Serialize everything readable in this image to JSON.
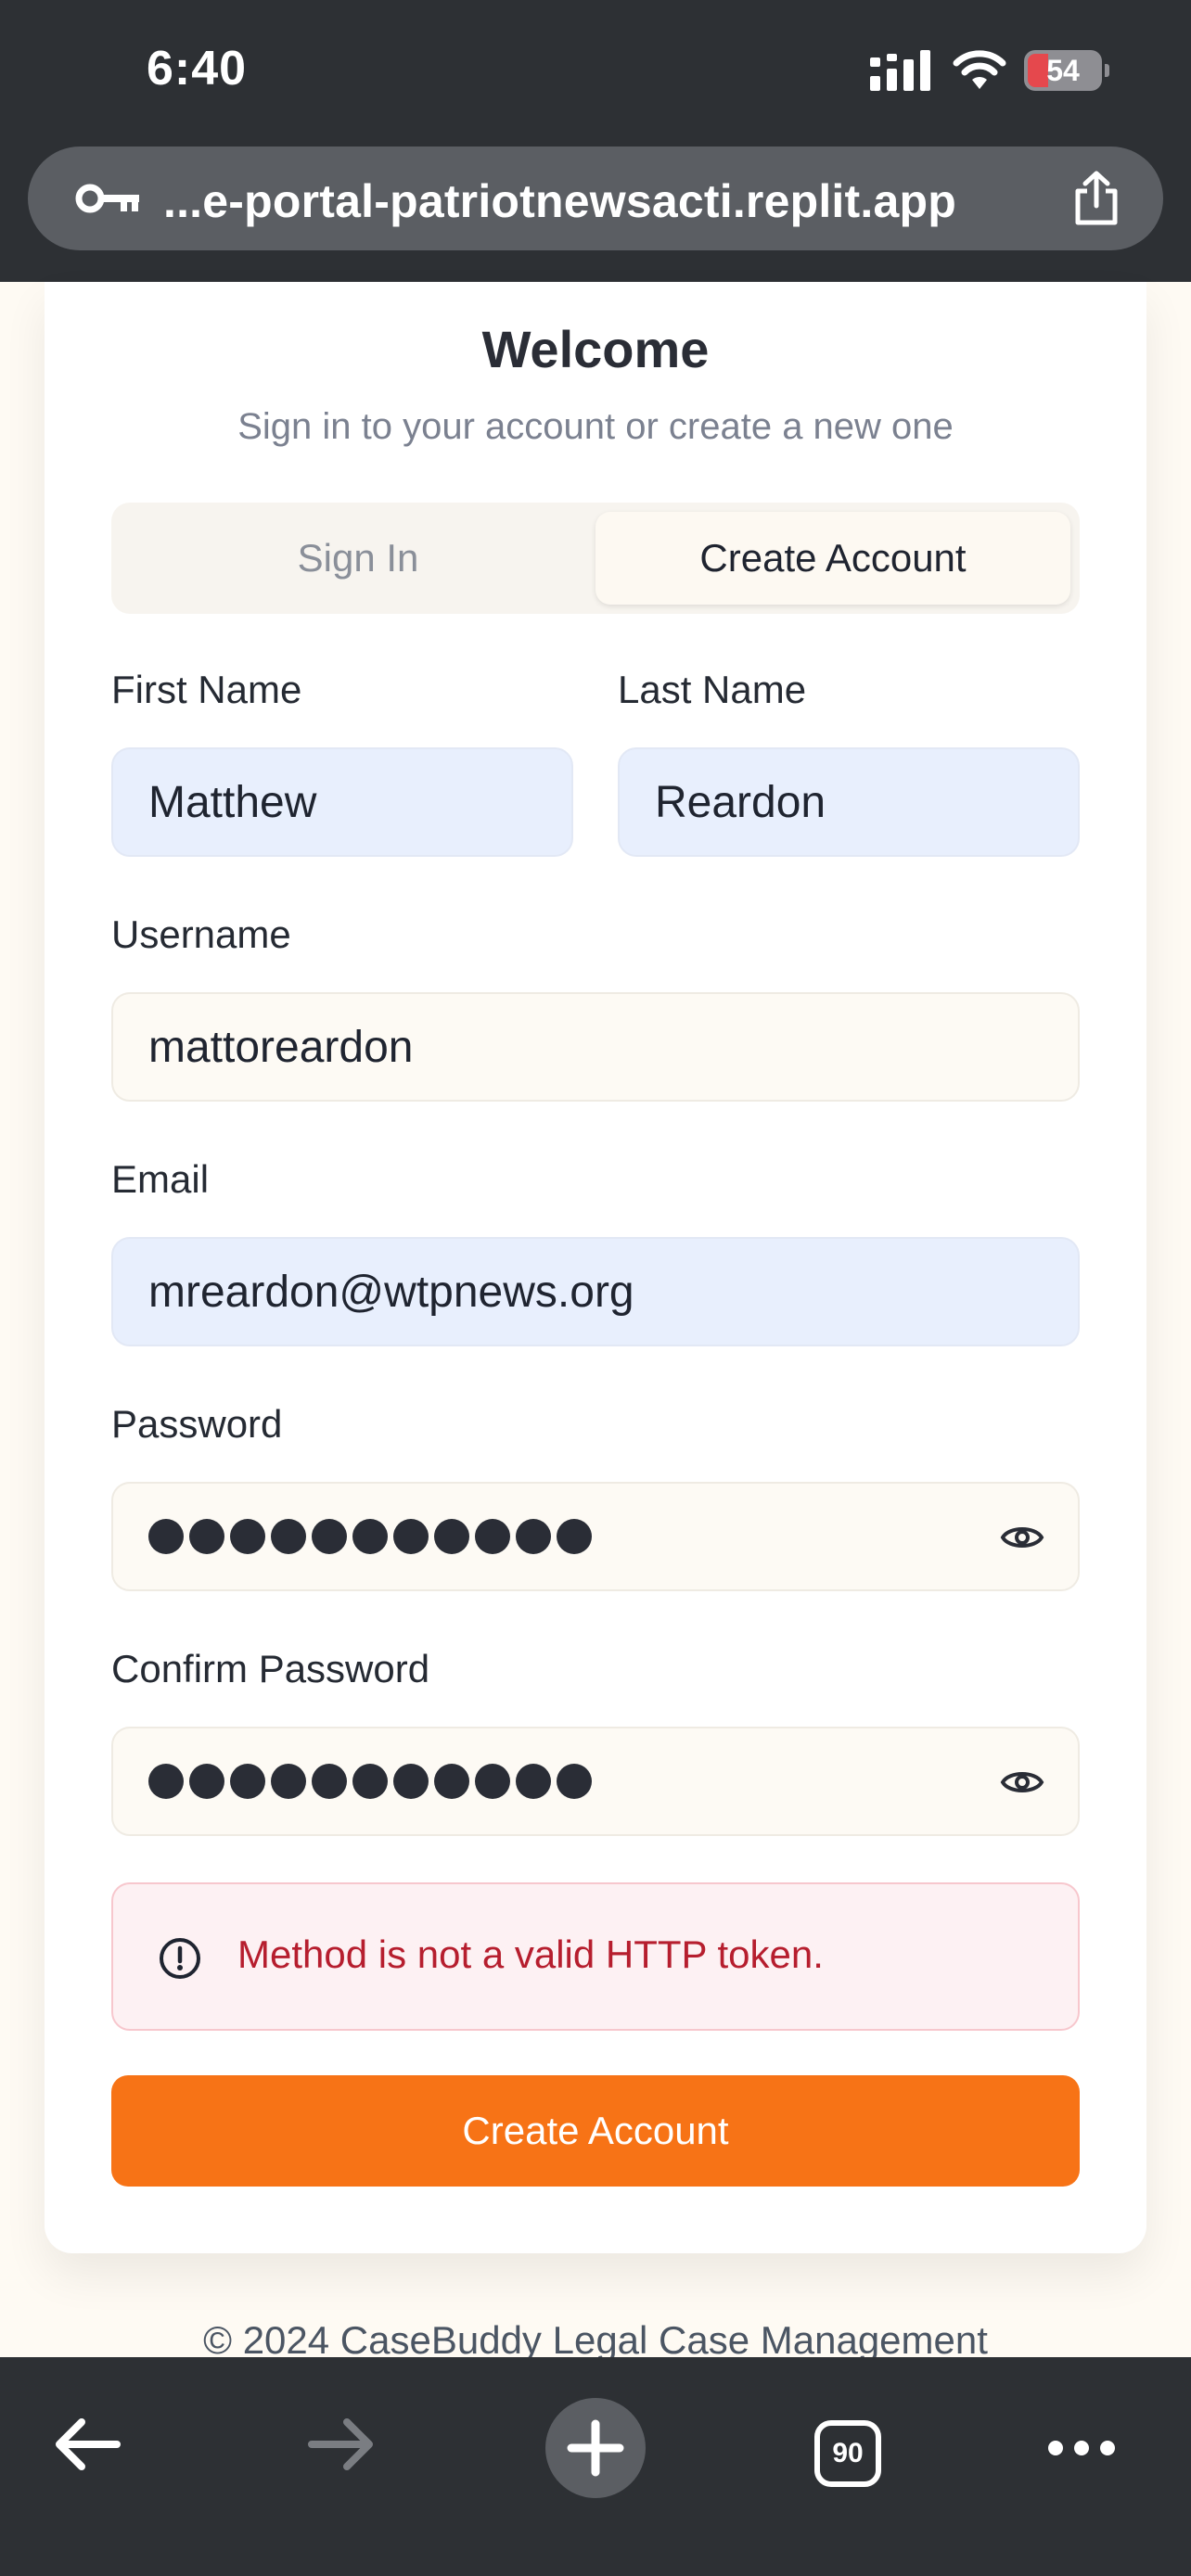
{
  "status_bar": {
    "time": "6:40",
    "battery": "54"
  },
  "browser": {
    "url": "...e-portal-patriotnewsacti.replit.app",
    "tab_count": "90"
  },
  "auth": {
    "title": "Welcome",
    "subtitle": "Sign in to your account or create a new one",
    "tabs": [
      {
        "label": "Sign In",
        "active": false
      },
      {
        "label": "Create Account",
        "active": true
      }
    ],
    "fields": {
      "first_name": {
        "label": "First Name",
        "value": "Matthew"
      },
      "last_name": {
        "label": "Last Name",
        "value": "Reardon"
      },
      "username": {
        "label": "Username",
        "value": "mattoreardon"
      },
      "email": {
        "label": "Email",
        "value": "mreardon@wtpnews.org"
      },
      "password": {
        "label": "Password",
        "masked_length": 11
      },
      "confirm_password": {
        "label": "Confirm Password",
        "masked_length": 11
      }
    },
    "error": "Method is not a valid HTTP token.",
    "submit_label": "Create Account"
  },
  "footer": {
    "text": "© 2024 CaseBuddy Legal Case Management"
  },
  "icons": {
    "status": [
      "signal-icon",
      "wifi-icon",
      "battery-icon"
    ],
    "url_bar": [
      "key-icon",
      "share-icon"
    ],
    "fields": [
      "eye-icon"
    ],
    "alert": [
      "alert-circle-icon"
    ],
    "toolbar": [
      "back-arrow-icon",
      "forward-arrow-icon",
      "plus-icon",
      "tabs-icon",
      "more-icon"
    ]
  },
  "colors": {
    "primary": "#f77316",
    "error_text": "#b61e2e",
    "error_bg": "#fdf1f3",
    "autofill_bg": "#e8effd",
    "chrome": "#2d3034"
  }
}
